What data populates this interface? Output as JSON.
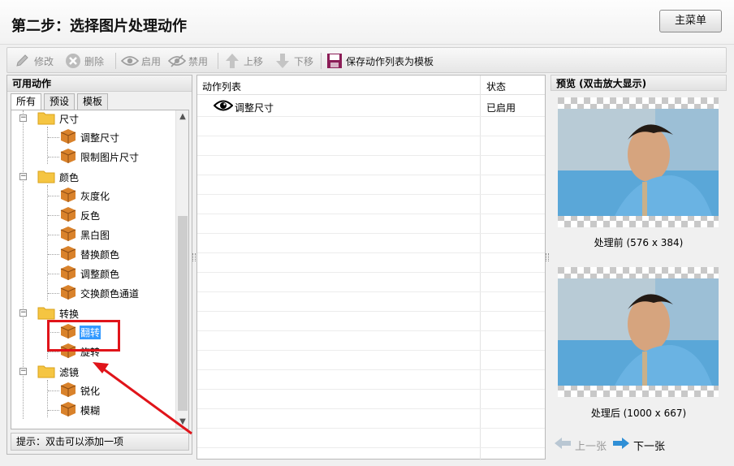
{
  "header": {
    "title": "第二步：选择图片处理动作",
    "main_menu_label": "主菜单"
  },
  "toolbar": {
    "edit_label": "修改",
    "delete_label": "删除",
    "enable_label": "启用",
    "disable_label": "禁用",
    "move_up_label": "上移",
    "move_down_label": "下移",
    "save_template_label": "保存动作列表为模板"
  },
  "left_panel": {
    "title": "可用动作",
    "tabs": [
      "所有",
      "预设",
      "模板"
    ],
    "selected_tab": "所有",
    "tree": {
      "group_size": "尺寸",
      "resize": "调整尺寸",
      "limit_size": "限制图片尺寸",
      "group_color": "颜色",
      "grayscale": "灰度化",
      "invert": "反色",
      "black_white": "黑白图",
      "replace_color": "替换颜色",
      "adjust_color": "调整颜色",
      "swap_channels": "交换颜色通道",
      "group_transform": "转换",
      "flip": "翻转",
      "rotate": "旋转",
      "group_filter": "滤镜",
      "sharpen": "锐化",
      "blur": "模糊"
    },
    "selected_item": "翻转",
    "hint": "提示：双击可以添加一项"
  },
  "action_list": {
    "col_action": "动作列表",
    "col_status": "状态",
    "rows": [
      {
        "name": "调整尺寸",
        "status": "已启用"
      }
    ]
  },
  "preview": {
    "title": "预览 (双击放大显示)",
    "before_caption": "处理前 (576 x 384)",
    "after_caption": "处理后 (1000 x 667)",
    "prev_label": "上一张",
    "next_label": "下一张"
  },
  "colors": {
    "selection": "#3399ff",
    "annotation_red": "#e0141a",
    "folder_yellow": "#f5c542",
    "box_orange": "#d9822b"
  }
}
